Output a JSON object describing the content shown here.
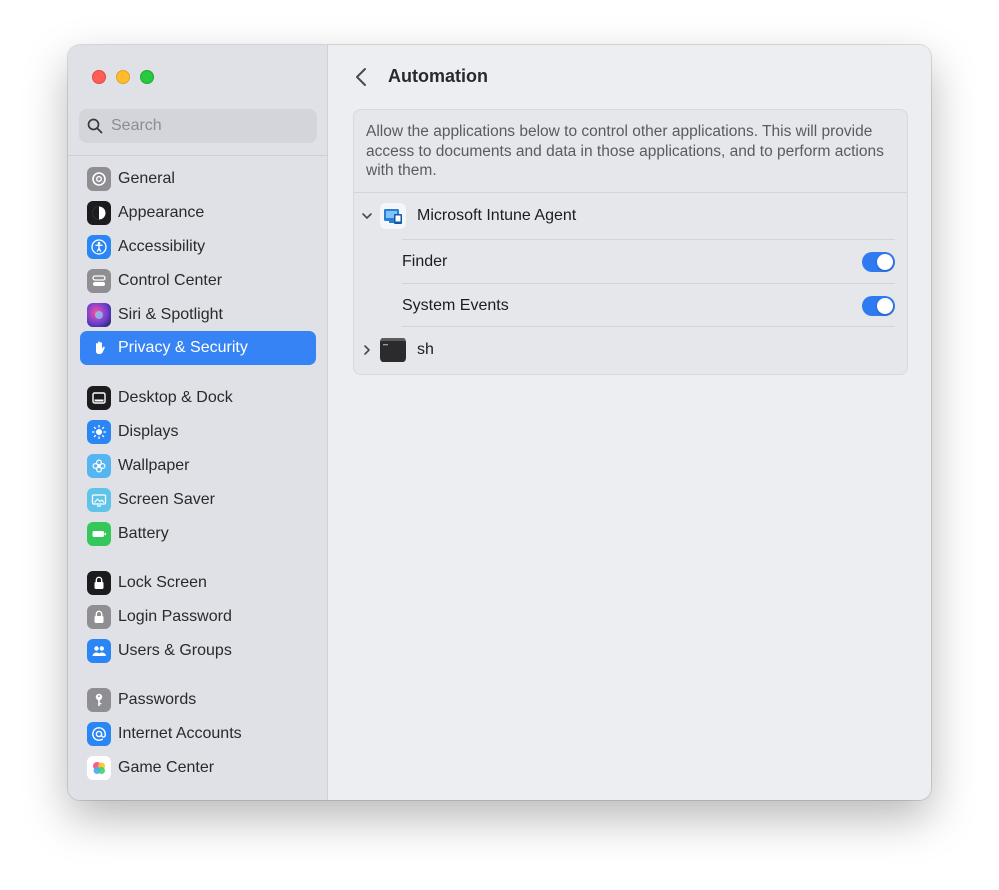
{
  "window": {
    "traffic_lights": [
      "close",
      "minimize",
      "zoom"
    ]
  },
  "sidebar": {
    "search_placeholder": "Search",
    "items": [
      {
        "label": "General",
        "icon": "gear-icon",
        "color": "#8e8e93"
      },
      {
        "label": "Appearance",
        "icon": "appearance-icon",
        "color": "#1c1c1e"
      },
      {
        "label": "Accessibility",
        "icon": "accessibility-icon",
        "color": "#2a86f5"
      },
      {
        "label": "Control Center",
        "icon": "control-center-icon",
        "color": "#8e8e93"
      },
      {
        "label": "Siri & Spotlight",
        "icon": "siri-icon",
        "color": "#6b3fd1"
      },
      {
        "label": "Privacy & Security",
        "icon": "hand-icon",
        "color": "#3683f5",
        "selected": true
      },
      {
        "label": "Desktop & Dock",
        "icon": "dock-icon",
        "color": "#1c1c1e"
      },
      {
        "label": "Displays",
        "icon": "sun-icon",
        "color": "#2a86f5"
      },
      {
        "label": "Wallpaper",
        "icon": "flower-icon",
        "color": "#55b5f0"
      },
      {
        "label": "Screen Saver",
        "icon": "screen-saver-icon",
        "color": "#5fc4e8"
      },
      {
        "label": "Battery",
        "icon": "battery-icon",
        "color": "#34c759"
      },
      {
        "label": "Lock Screen",
        "icon": "lock-icon",
        "color": "#1c1c1e"
      },
      {
        "label": "Login Password",
        "icon": "padlock-icon",
        "color": "#8e8e93"
      },
      {
        "label": "Users & Groups",
        "icon": "users-icon",
        "color": "#2a86f5"
      },
      {
        "label": "Passwords",
        "icon": "key-icon",
        "color": "#8e8e93"
      },
      {
        "label": "Internet Accounts",
        "icon": "at-icon",
        "color": "#2a86f5"
      },
      {
        "label": "Game Center",
        "icon": "game-center-icon",
        "color": "#f5a623"
      }
    ]
  },
  "main": {
    "title": "Automation",
    "description": "Allow the applications below to control other applications. This will provide access to documents and data in those applications, and to perform actions with them.",
    "apps": [
      {
        "name": "Microsoft Intune Agent",
        "expanded": true,
        "icon": "intune-icon",
        "targets": [
          {
            "name": "Finder",
            "enabled": true
          },
          {
            "name": "System Events",
            "enabled": true
          }
        ]
      },
      {
        "name": "sh",
        "expanded": false,
        "icon": "terminal-icon",
        "targets": []
      }
    ]
  },
  "colors": {
    "accent": "#3683f5",
    "toggle_on": "#2f7af0",
    "sidebar_bg": "#dfe1e6",
    "content_bg": "#eceef2"
  }
}
